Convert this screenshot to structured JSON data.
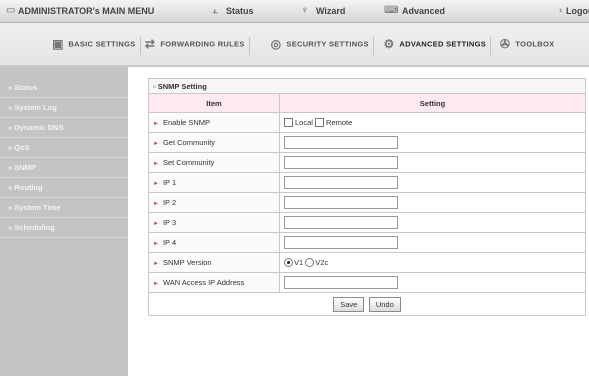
{
  "topbar": {
    "title": "ADMINISTRATOR's MAIN MENU",
    "status": "Status",
    "wizard": "Wizard",
    "advanced": "Advanced",
    "logout": "Logou"
  },
  "tabs": [
    {
      "label": "BASIC SETTINGS",
      "icon": "basic-settings-icon"
    },
    {
      "label": "FORWARDING RULES",
      "icon": "forwarding-rules-icon"
    },
    {
      "label": "SECURITY SETTINGS",
      "icon": "security-settings-icon"
    },
    {
      "label": "ADVANCED SETTINGS",
      "icon": "advanced-settings-icon"
    },
    {
      "label": "TOOLBOX",
      "icon": "toolbox-icon"
    }
  ],
  "sidebar": {
    "items": [
      {
        "label": "Status"
      },
      {
        "label": "System Log"
      },
      {
        "label": "Dynamic DNS"
      },
      {
        "label": "QoS"
      },
      {
        "label": "SNMP"
      },
      {
        "label": "Routing"
      },
      {
        "label": "System Time"
      },
      {
        "label": "Scheduling"
      }
    ]
  },
  "panel": {
    "title": "SNMP Setting",
    "col_item": "Item",
    "col_setting": "Setting",
    "rows": {
      "enable_snmp": {
        "label": "Enable SNMP",
        "local": "Local",
        "remote": "Remote"
      },
      "get_community": {
        "label": "Get Community",
        "value": ""
      },
      "set_community": {
        "label": "Set Community",
        "value": ""
      },
      "ip1": {
        "label": "IP 1",
        "value": ""
      },
      "ip2": {
        "label": "IP 2",
        "value": ""
      },
      "ip3": {
        "label": "IP 3",
        "value": ""
      },
      "ip4": {
        "label": "IP 4",
        "value": ""
      },
      "snmp_version": {
        "label": "SNMP Version",
        "v1": "V1",
        "v2c": "V2c",
        "selected": "V1"
      },
      "wan_ip": {
        "label": "WAN Access IP Address",
        "value": ""
      }
    },
    "save": "Save",
    "undo": "Undo"
  },
  "colors": {
    "accent": "#c0507a",
    "header_bg": "#fde9ee",
    "sidebar_bg": "#c4c4c4"
  }
}
